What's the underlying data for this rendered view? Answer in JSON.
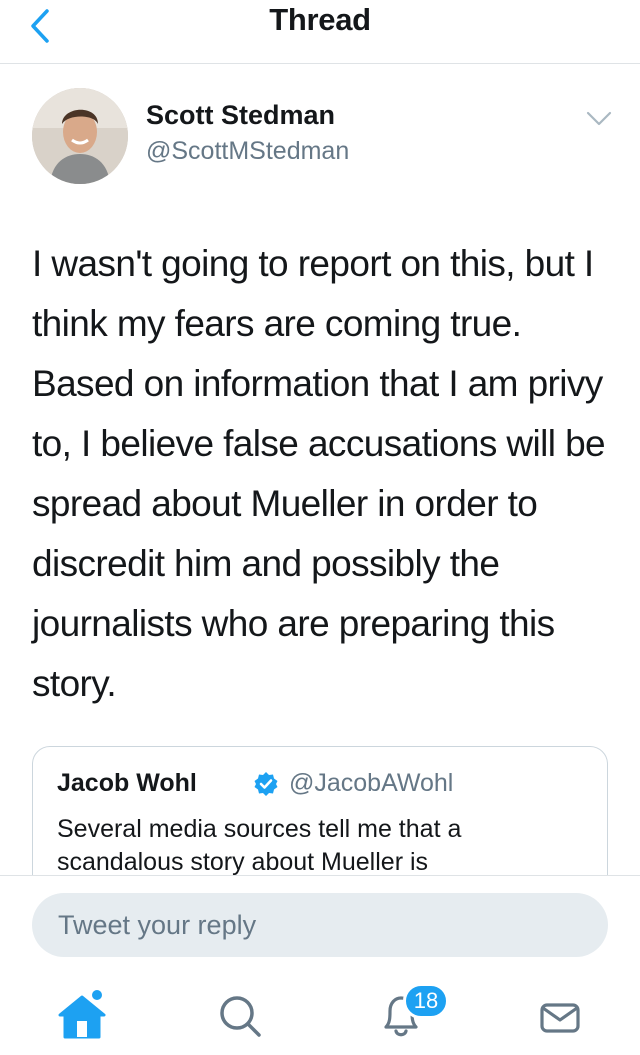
{
  "header": {
    "title": "Thread",
    "back_icon": "chevron-left-icon"
  },
  "tweet": {
    "author_name": "Scott Stedman",
    "author_handle": "@ScottMStedman",
    "text": "I wasn't going to report on this, but I think my fears are coming true. Based on information that I am privy to, I believe false accusations will be spread about Mueller in order to discredit him and possibly the journalists who are preparing this story.",
    "menu_icon": "chevron-down-icon"
  },
  "quoted_tweet": {
    "author_name": "Jacob Wohl",
    "author_handle": "@JacobAWohl",
    "verified_icon": "verified-badge-icon",
    "text": "Several media sources tell me that a scandalous story about Mueller is"
  },
  "reply": {
    "placeholder": "Tweet your reply"
  },
  "tab_bar": {
    "notifications_count": "18"
  },
  "colors": {
    "accent": "#1da1f2",
    "secondary_text": "#657786",
    "input_bg": "#e6ecf0"
  }
}
